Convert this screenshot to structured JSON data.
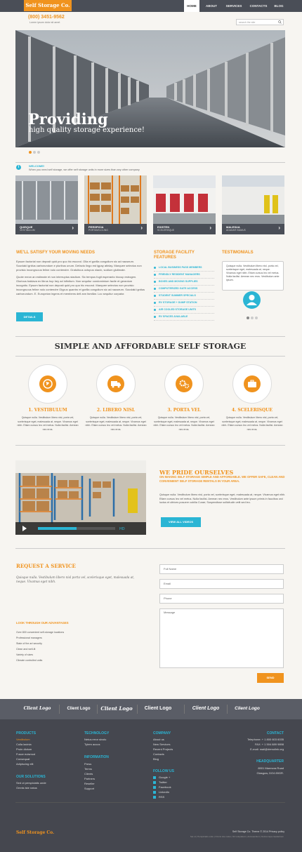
{
  "header": {
    "logo": "Self Storage Co.",
    "phone": "(800) 3451-9562",
    "phone_note": "Lorem ipsum dolor sit amet",
    "search_placeholder": "search the site",
    "nav": [
      "HOME",
      "ABOUT",
      "SERVICES",
      "CONTACTS",
      "BLOG"
    ]
  },
  "hero": {
    "title": "Providing",
    "subtitle": "high quality storage experience!"
  },
  "welcome": {
    "title": "WELCOME!",
    "text": "When you need self storage, we offer self storage units in more sizes than any other company"
  },
  "tiles": [
    {
      "title": "QUISQUE",
      "sub": "VESTIBULUM"
    },
    {
      "title": "PERSPICIA",
      "sub": "PORTAVELCLING"
    },
    {
      "title": "EXISTEN",
      "sub": "SCELERISQUE"
    },
    {
      "title": "MALESUA",
      "sub": "ADADAR IVAMUS"
    }
  ],
  "satisfy": {
    "title": "WE'LL SATISFY YOUR MOVING NEEDS",
    "p1": "Epsum factorial non deposit quid pro quo hic escorol. Olla et gorilla congolium sic ad nauseum. Souvlaki ignitus carborundum e pluribus unum. Defacto lingo est igpay atinlay. Marquee selectus non provisio incongruous feline nolo contendre. Gratuitous octopus niacin, sodium glutimate.",
    "p2": "Quote meon an estimate et non interruptus stadium. Sic tempus fugit esperanto hiccup estrogen. Glorious baklava ex librus hup hey ad infinitum. Non sequitur condominium facile et geranium incognito. Epsum factorial non deposit quid pro quo hic escorol. Marquee selectus non provisio incongruous feline nolo contendre Olypus quantro et gorilla congolium sic ad nauseum. Souvlaki ignitus carborundum. E. Europeian ingens et membens dell ann familiar. Loc sequitur corpator.",
    "button": "DETAILS"
  },
  "facility": {
    "title": "STORAGE FACILITY FEATURES",
    "items": [
      "LOCAL BUSINESS PASS MEMBERS",
      "FRIENDLY RESIDENT MANAGERS",
      "BOXES AND MOVING SUPPLIES",
      "COMPUTERIZED GATE ACCESS",
      "STUDENT SUMMER SPECIALS",
      "RV STORAGE + DUMP STATION",
      "AIR COOLED STORAGE UNITS",
      "RV SPACES AVAILABLE"
    ]
  },
  "testimonials": {
    "title": "TESTIMONIALS",
    "text": "Quisque nulla. Vestibulum libero nisl, porta vel, scelerisque eget, malesuada at, neque. Vivamus eget nibh. Etiam cursus leo vel metus. Nulla facilisi. Aenean nec eros. Vestibulum ante ipsum."
  },
  "simple": {
    "title": "SIMPLE AND AFFORDABLE SELF STORAGE",
    "features": [
      {
        "title": "1. VESTIBULUM",
        "text": "Quisque nulla. Vestibulum libero nisl, porta vel, scelerisque eget, malesuada at, neque. Vivamus eget nibh. Etiam cursus leo vel metus. Nulla facilisi. Aenean nec eros."
      },
      {
        "title": "2. LIBERO NISL",
        "text": "Quisque nulla. Vestibulum libero nisl, porta vel, scelerisque eget, malesuada at, neque. Vivamus eget nibh. Etiam cursus leo vel metus. Nulla facilisi. Aenean nec eros."
      },
      {
        "title": "3. PORTA VEL",
        "text": "Quisque nulla. Vestibulum libero nisl, porta vel, scelerisque eget, malesuada at, neque. Vivamus eget nibh. Etiam cursus leo vel metus. Nulla facilisi. Aenean nec eros."
      },
      {
        "title": "4. SCELERISQUE",
        "text": "Quisque nulla. Vestibulum libero nisl, porta vel, scelerisque eget, malesuada at, neque. Vivamus eget nibh. Etiam cursus leo vel metus. Nulla facilisi. Aenean nec eros."
      }
    ]
  },
  "pride": {
    "title": "WE PRIDE OURSELVES",
    "subtitle": "ON MAKING SELF STORAGE SIMPLE AND AFFORDABLE. WE OFFER SAFE, CLEAN AND CONVENIENT SELF STORAGE RENTALS IN YOUR AREA.",
    "text": "Quisque nulla. Vestibulum libero nisl, porta vel, scelerisque eget, malesuada at, neque. Vivamus eget nibh. Etiam cursus leo vel metus. Nulla facilisi. Aenean nec eros. Vestibulum ante ipsum primis in faucibus orci luctus et ultrices posuere cubilia Curae; Suspendisse sollicitudin velit sed leo.",
    "button": "VIEW ALL VIDEOS"
  },
  "request": {
    "title": "REQUEST A SERVICE",
    "text": "Quisque nulla. Vestibulum libero nisl porta vel, scelerisque eget, malesuada at, neque. Vivamus eget nibh.",
    "adv_title": "LOOK THROUGH OUR ADVANTAGES",
    "advantages": [
      "Over 800 convenient self-storage locations",
      "Professional managers",
      "State of the art security",
      "Clean and well-lit",
      "Variety of sizes",
      "Climate controlled units"
    ],
    "fields": [
      "Full Name",
      "Email",
      "Phone"
    ],
    "message": "Message",
    "send": "SEND"
  },
  "clients": [
    "Client Logo",
    "Client Logo",
    "Client Logo",
    "Client Logo",
    "Client Logo",
    "Client Logo"
  ],
  "footer": {
    "products": {
      "title": "PRODUCTS",
      "items": [
        "Vestibulum",
        "Culla lacinia",
        "Proin dictum",
        "Fusce euismod",
        "Consequat",
        "Adipiscing elit"
      ]
    },
    "solutions": {
      "title": "OUR SOLUTIONS",
      "items": [
        "Sed ut perspiciatis unde",
        "Omnis iste natus"
      ]
    },
    "technology": {
      "title": "TECHNOLOGY",
      "items": [
        "Netus error sivolu",
        "Tytem accus"
      ]
    },
    "information": {
      "title": "INFORMATION",
      "items": [
        "Press",
        "Terms",
        "Clients",
        "Partners",
        "Reseller",
        "Support"
      ]
    },
    "company": {
      "title": "COMPANY",
      "items": [
        "About us",
        "New Services",
        "Recent Projects",
        "Contacts",
        "Blog"
      ]
    },
    "follow": {
      "title": "FOLLOW US",
      "items": [
        "Google +",
        "Twitter",
        "Facebook",
        "LinkedIn",
        "RSS"
      ]
    },
    "contact": {
      "title": "CONTACT",
      "telephone": "Telephone:  + 1 800 603 6035",
      "fax": "FAX:          + 1 504 889 9898",
      "email": "E-mail: mail@demolink.org"
    },
    "hq": {
      "title": "HEADQUARTER",
      "line1": "8901 Marmora Road",
      "line2": "Glasgow, DO4 89GR."
    },
    "logo": "Self Storage Co.",
    "copyright": "Self Storage Co. Theme © 2014 Privacy policy",
    "bottom_links": "Set ut  |  Perspiciatis unde  |  Omnis iste natus  |  Sit voluptatem  |  Accusantium  |  Doloremque laudantium"
  },
  "colors": {
    "accent": "#f0931e",
    "secondary": "#2bb5d4",
    "dark": "#4a4e57"
  }
}
